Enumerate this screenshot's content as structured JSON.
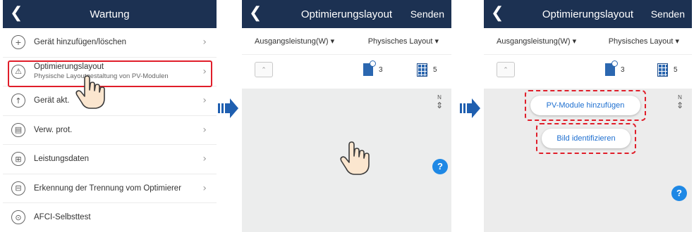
{
  "panel1": {
    "title": "Wartung",
    "items": [
      {
        "label": "Gerät hinzufügen/löschen",
        "sub": "",
        "icon": "+"
      },
      {
        "label": "Optimierungslayout",
        "sub": "Physische Layoutgestaltung von PV-Modulen",
        "icon": "⚠"
      },
      {
        "label": "Gerät akt.",
        "sub": "",
        "icon": "↑"
      },
      {
        "label": "Verw. prot.",
        "sub": "",
        "icon": "▤"
      },
      {
        "label": "Leistungsdaten",
        "sub": "",
        "icon": "⊞"
      },
      {
        "label": "Erkennung der Trennung vom Optimierer",
        "sub": "",
        "icon": "⊟"
      },
      {
        "label": "AFCI-Selbsttest",
        "sub": "",
        "icon": "⊙"
      }
    ]
  },
  "panel2": {
    "title": "Optimierungslayout",
    "send": "Senden",
    "dropdown_left": "Ausgangsleistung(W)",
    "dropdown_right": "Physisches Layout",
    "optimizer_count": "3",
    "pv_count": "5",
    "north": "N",
    "help": "?"
  },
  "panel3": {
    "title": "Optimierungslayout",
    "send": "Senden",
    "dropdown_left": "Ausgangsleistung(W)",
    "dropdown_right": "Physisches Layout",
    "optimizer_count": "3",
    "pv_count": "5",
    "north": "N",
    "help": "?",
    "add_pv_button": "PV-Module hinzufügen",
    "identify_button": "Bild identifizieren"
  },
  "icons": {
    "back": "back-chevron-icon",
    "chevron": "chevron-right-icon",
    "dropdown_caret": "▾",
    "compass_needle": "⇕"
  },
  "colors": {
    "header": "#1c3152",
    "highlight": "#e01e2a",
    "accent": "#1e88e5",
    "arrow": "#1f5fb0"
  }
}
